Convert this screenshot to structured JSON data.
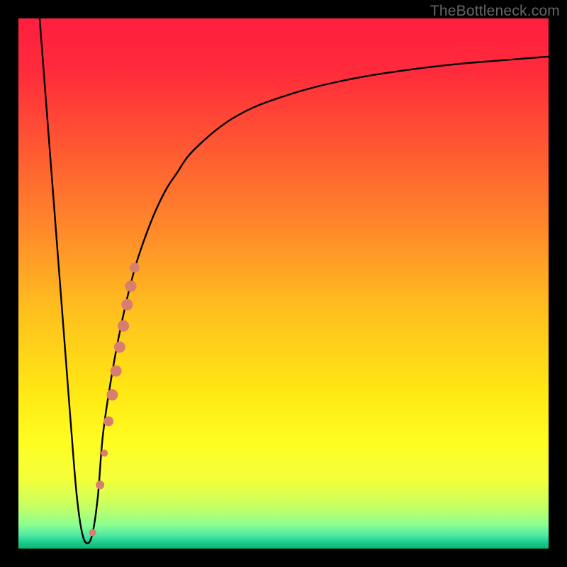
{
  "watermark": "TheBottleneck.com",
  "chart_data": {
    "type": "line",
    "title": "",
    "xlabel": "",
    "ylabel": "",
    "xlim": [
      0,
      100
    ],
    "ylim": [
      0,
      100
    ],
    "grid": false,
    "series": [
      {
        "name": "bottleneck-curve",
        "x": [
          4,
          5,
          6,
          7,
          8,
          9,
          10,
          11,
          12,
          13,
          14,
          15,
          16,
          18,
          20,
          22,
          24,
          26,
          28,
          30,
          32,
          35,
          38,
          41,
          45,
          50,
          55,
          60,
          65,
          70,
          75,
          80,
          85,
          90,
          95,
          100
        ],
        "values": [
          100,
          87,
          74,
          61,
          48,
          35,
          22,
          10,
          3,
          1,
          3,
          10,
          22,
          35,
          45,
          53,
          59,
          64,
          68,
          71,
          74,
          77,
          79.5,
          81.5,
          83.5,
          85.3,
          86.8,
          88,
          89,
          89.8,
          90.5,
          91.1,
          91.6,
          92,
          92.4,
          92.8
        ]
      }
    ],
    "marker_band": {
      "name": "highlight-dots",
      "color": "#d87d6f",
      "points": [
        {
          "x": 14.0,
          "y": 3.0,
          "r": 5
        },
        {
          "x": 15.4,
          "y": 12.0,
          "r": 6
        },
        {
          "x": 16.2,
          "y": 18.0,
          "r": 5
        },
        {
          "x": 17.0,
          "y": 24.0,
          "r": 7
        },
        {
          "x": 17.7,
          "y": 29.0,
          "r": 8
        },
        {
          "x": 18.4,
          "y": 33.5,
          "r": 8
        },
        {
          "x": 19.1,
          "y": 38.0,
          "r": 8
        },
        {
          "x": 19.8,
          "y": 42.0,
          "r": 8
        },
        {
          "x": 20.5,
          "y": 46.0,
          "r": 8
        },
        {
          "x": 21.2,
          "y": 49.5,
          "r": 8
        },
        {
          "x": 21.9,
          "y": 53.0,
          "r": 7
        }
      ]
    },
    "gradient_stops": [
      {
        "offset": 0.0,
        "color": "#ff1f3f"
      },
      {
        "offset": 0.1,
        "color": "#ff2b3b"
      },
      {
        "offset": 0.25,
        "color": "#ff5a32"
      },
      {
        "offset": 0.4,
        "color": "#ff8a2a"
      },
      {
        "offset": 0.55,
        "color": "#ffbf1e"
      },
      {
        "offset": 0.7,
        "color": "#ffe714"
      },
      {
        "offset": 0.8,
        "color": "#fffd22"
      },
      {
        "offset": 0.87,
        "color": "#f3ff3a"
      },
      {
        "offset": 0.92,
        "color": "#c7ff63"
      },
      {
        "offset": 0.955,
        "color": "#8dff90"
      },
      {
        "offset": 0.975,
        "color": "#4de8a5"
      },
      {
        "offset": 0.99,
        "color": "#17c987"
      },
      {
        "offset": 1.0,
        "color": "#0fb575"
      }
    ]
  }
}
